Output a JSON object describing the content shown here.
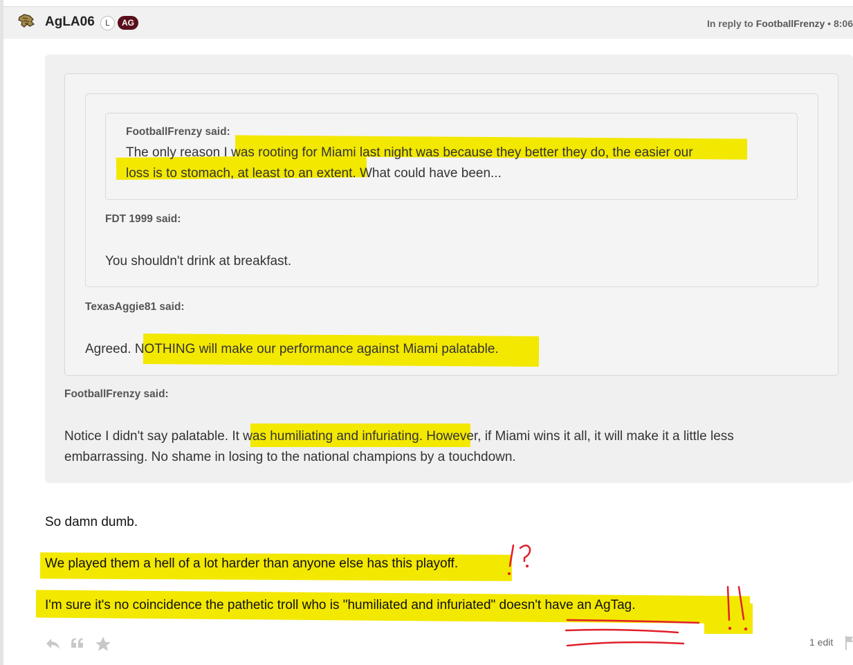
{
  "post": {
    "username": "AgLA06",
    "badge_l": "L",
    "badge_ag": "AG",
    "reply_prefix": "In reply to ",
    "reply_to": "FootballFrenzy",
    "reply_time": " • 8:06"
  },
  "quotes": {
    "level4": {
      "author": "FootballFrenzy said:",
      "line1_pre": "The only reason I ",
      "line1_hl": "was rooting for Miami last night was because they better they do, the easier our",
      "line2_hl": "loss is to stomach, at least to an exten",
      "line2_post": "t. What could have been..."
    },
    "level3": {
      "author": "FDT 1999 said:",
      "text": "You shouldn't drink at breakfast."
    },
    "level2": {
      "author": "TexasAggie81 said:",
      "text_pre": "Agreed. N",
      "text_hl": "OTHING will make our performance against Miami palatable."
    },
    "level1": {
      "author": "FootballFrenzy said:",
      "line1_pre": "Notice I didn't say palatable. ",
      "line1_hl": "It was humiliating and infuriating.",
      "line1_post": " However, if Miami wins it all, it will make it a little less",
      "line2": "embarrassing. No shame in losing to the national champions by a touchdown."
    }
  },
  "body": {
    "p1": "So damn dumb.",
    "p2": "We played them a hell of a lot harder than anyone else has this playoff.",
    "p3": "I'm sure it's no coincidence the pathetic troll who is \"humiliated and infuriated\" doesn't have an AgTag."
  },
  "annotations": {
    "mark1": "!?",
    "mark2": "!!"
  },
  "footer": {
    "edit_count": "1 edit"
  },
  "colors": {
    "highlight": "#f3e800",
    "badge_ag": "#5a0f1c",
    "ink_red": "#e0202a"
  },
  "icons": [
    "avatar-logo-icon",
    "reply-icon",
    "quote-icon",
    "star-icon",
    "flag-icon"
  ]
}
